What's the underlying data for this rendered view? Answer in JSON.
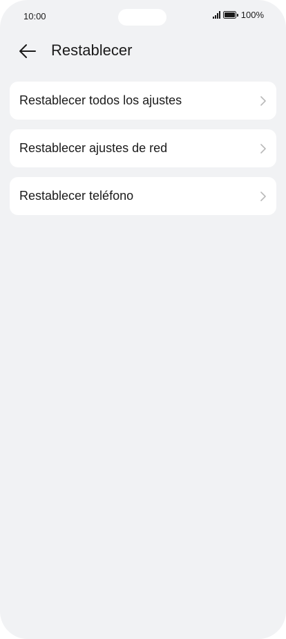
{
  "status_bar": {
    "time": "10:00",
    "battery": "100%"
  },
  "header": {
    "title": "Restablecer",
    "back_icon": "arrow-left-icon"
  },
  "list": {
    "items": [
      {
        "label": "Restablecer todos los ajustes",
        "icon": "chevron-right-icon"
      },
      {
        "label": "Restablecer ajustes de red",
        "icon": "chevron-right-icon"
      },
      {
        "label": "Restablecer teléfono",
        "icon": "chevron-right-icon"
      }
    ]
  },
  "colors": {
    "background": "#f1f2f4",
    "card": "#ffffff",
    "text": "#1a1a1a",
    "chevron": "#b8b8b8"
  }
}
